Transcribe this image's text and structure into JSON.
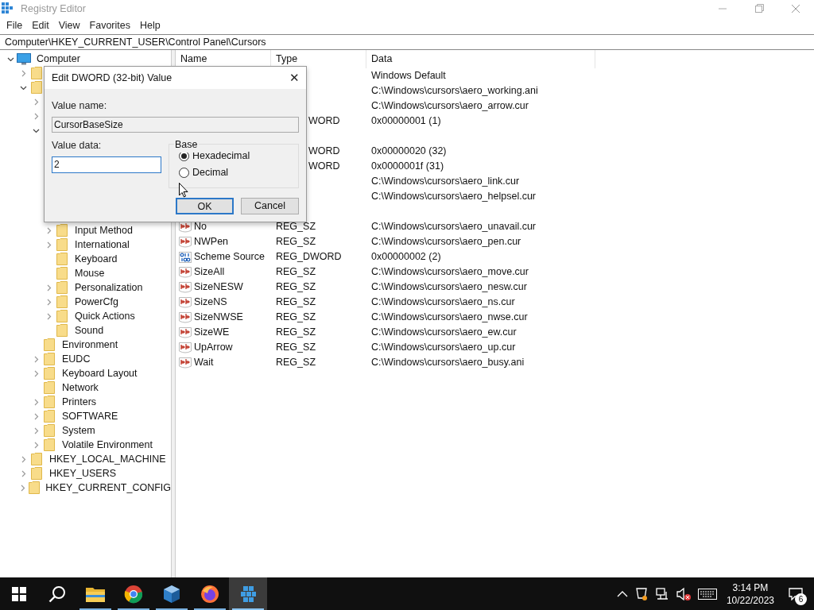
{
  "window": {
    "title": "Registry Editor"
  },
  "menu": [
    "File",
    "Edit",
    "View",
    "Favorites",
    "Help"
  ],
  "address": "Computer\\HKEY_CURRENT_USER\\Control Panel\\Cursors",
  "tree": [
    {
      "label": "Computer",
      "kind": "computer",
      "expanded": true,
      "children": [
        {
          "expanded": false
        },
        {
          "expanded": true,
          "children": [
            {
              "expanded": false
            },
            {
              "expanded": false
            },
            {
              "expanded": true,
              "children": [
                {
                  "label": "Input Method",
                  "expanded": false
                },
                {
                  "label": "International",
                  "expanded": false
                },
                {
                  "label": "Keyboard"
                },
                {
                  "label": "Mouse"
                },
                {
                  "label": "Personalization",
                  "expanded": false
                },
                {
                  "label": "PowerCfg",
                  "expanded": false
                },
                {
                  "label": "Quick Actions",
                  "expanded": false
                },
                {
                  "label": "Sound"
                }
              ]
            },
            {
              "label": "Environment"
            },
            {
              "label": "EUDC",
              "expanded": false
            },
            {
              "label": "Keyboard Layout",
              "expanded": false
            },
            {
              "label": "Network"
            },
            {
              "label": "Printers",
              "expanded": false
            },
            {
              "label": "SOFTWARE",
              "expanded": false
            },
            {
              "label": "System",
              "expanded": false
            },
            {
              "label": "Volatile Environment",
              "expanded": false
            }
          ]
        },
        {
          "label": "HKEY_LOCAL_MACHINE",
          "expanded": false
        },
        {
          "label": "HKEY_USERS",
          "expanded": false
        },
        {
          "label": "HKEY_CURRENT_CONFIG",
          "expanded": false
        }
      ]
    }
  ],
  "list": {
    "columns": [
      "Name",
      "Type",
      "Data"
    ],
    "rows": [
      {
        "data": "Windows Default"
      },
      {
        "data": "C:\\Windows\\cursors\\aero_working.ani"
      },
      {
        "data": "C:\\Windows\\cursors\\aero_arrow.cur"
      },
      {
        "type": "WORD",
        "data": "0x00000001 (1)"
      },
      {
        "kind": "empty"
      },
      {
        "type": "WORD",
        "data": "0x00000020 (32)"
      },
      {
        "type": "WORD",
        "data": "0x0000001f (31)"
      },
      {
        "data": "C:\\Windows\\cursors\\aero_link.cur"
      },
      {
        "data": "C:\\Windows\\cursors\\aero_helpsel.cur"
      },
      {
        "kind": "empty"
      },
      {
        "name": "No",
        "kind": "string",
        "type": "REG_SZ",
        "data": "C:\\Windows\\cursors\\aero_unavail.cur"
      },
      {
        "name": "NWPen",
        "kind": "string",
        "type": "REG_SZ",
        "data": "C:\\Windows\\cursors\\aero_pen.cur"
      },
      {
        "name": "Scheme Source",
        "kind": "binary",
        "type": "REG_DWORD",
        "data": "0x00000002 (2)"
      },
      {
        "name": "SizeAll",
        "kind": "string",
        "type": "REG_SZ",
        "data": "C:\\Windows\\cursors\\aero_move.cur"
      },
      {
        "name": "SizeNESW",
        "kind": "string",
        "type": "REG_SZ",
        "data": "C:\\Windows\\cursors\\aero_nesw.cur"
      },
      {
        "name": "SizeNS",
        "kind": "string",
        "type": "REG_SZ",
        "data": "C:\\Windows\\cursors\\aero_ns.cur"
      },
      {
        "name": "SizeNWSE",
        "kind": "string",
        "type": "REG_SZ",
        "data": "C:\\Windows\\cursors\\aero_nwse.cur"
      },
      {
        "name": "SizeWE",
        "kind": "string",
        "type": "REG_SZ",
        "data": "C:\\Windows\\cursors\\aero_ew.cur"
      },
      {
        "name": "UpArrow",
        "kind": "string",
        "type": "REG_SZ",
        "data": "C:\\Windows\\cursors\\aero_up.cur"
      },
      {
        "name": "Wait",
        "kind": "string",
        "type": "REG_SZ",
        "data": "C:\\Windows\\cursors\\aero_busy.ani"
      }
    ]
  },
  "dialog": {
    "title": "Edit DWORD (32-bit) Value",
    "close": "✕",
    "value_name_label": "Value name:",
    "value_name": "CursorBaseSize",
    "value_data_label": "Value data:",
    "value_data": "2",
    "base_label": "Base",
    "bases": [
      {
        "label": "Hexadecimal",
        "selected": true
      },
      {
        "label": "Decimal",
        "selected": false
      }
    ],
    "buttons": [
      {
        "label": "OK",
        "focused": true
      },
      {
        "label": "Cancel",
        "focused": false
      }
    ]
  },
  "taskbar": {
    "apps": [
      {
        "kind": "start"
      },
      {
        "kind": "search"
      },
      {
        "kind": "explorer",
        "running": true,
        "selected": false
      },
      {
        "kind": "chrome",
        "running": true,
        "selected": false
      },
      {
        "kind": "virtualbox",
        "running": true,
        "selected": false
      },
      {
        "kind": "firefox",
        "running": true,
        "selected": false
      },
      {
        "kind": "regedit",
        "running": true,
        "selected": true
      }
    ],
    "time": "3:14 PM",
    "date": "10/22/2023",
    "notifications": "6"
  }
}
